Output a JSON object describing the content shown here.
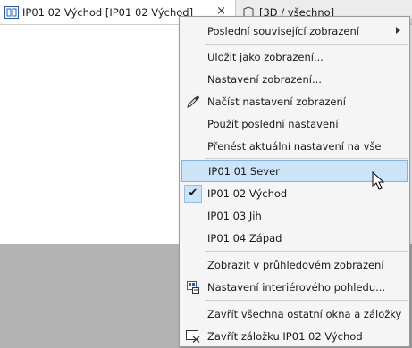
{
  "tabs": [
    {
      "title": "IP01 02 Východ [IP01 02 Východ]",
      "close": "×"
    },
    {
      "title": "[3D / všechno]"
    }
  ],
  "menu": {
    "items": [
      {
        "label": "Poslední související zobrazení"
      },
      {
        "label": "Uložit jako zobrazení..."
      },
      {
        "label": "Nastavení zobrazení..."
      },
      {
        "label": "Načíst nastavení zobrazení"
      },
      {
        "label": "Použít poslední nastavení"
      },
      {
        "label": "Přenést aktuální nastavení na vše"
      },
      {
        "label": "IP01 01 Sever"
      },
      {
        "label": "IP01 02 Východ",
        "check": "✔"
      },
      {
        "label": "IP01 03 Jih"
      },
      {
        "label": "IP01 04 Západ"
      },
      {
        "label": "Zobrazit v průhledovém zobrazení"
      },
      {
        "label": "Nastavení interiérového pohledu..."
      },
      {
        "label": "Zavřít všechna ostatní okna a záložky"
      },
      {
        "label": "Zavřít záložku IP01 02 Východ"
      }
    ]
  },
  "colors": {
    "highlight": "#cce4f7",
    "highlight_border": "#7fb4e3",
    "background_grey": "#b3b3b3"
  }
}
